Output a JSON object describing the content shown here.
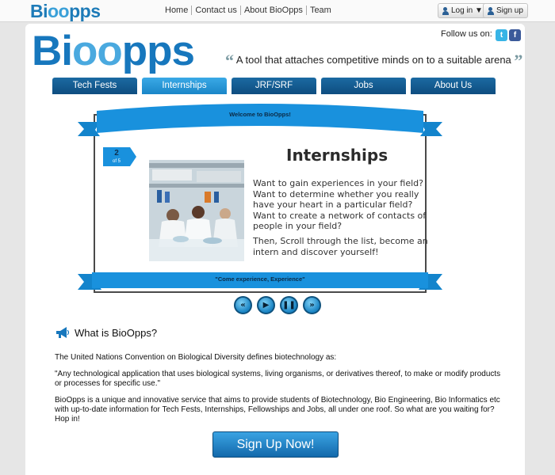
{
  "header": {
    "mini_logo_pre": "Bi",
    "mini_logo_dna": "oo",
    "mini_logo_post": "pps",
    "nav": [
      "Home",
      "Contact us",
      "About BioOpps",
      "Team"
    ],
    "login_label": "Log in ▼",
    "signup_label": "Sign up"
  },
  "brand": {
    "logo_pre": "Bi",
    "logo_dna": "oo",
    "logo_post": "pps",
    "follow_label": "Follow us on:",
    "tagline": "A tool that attaches competitive minds on to a suitable arena",
    "social": [
      "twitter-icon",
      "facebook-icon"
    ]
  },
  "tabs": [
    {
      "label": "Tech Fests",
      "active": false
    },
    {
      "label": "Internships",
      "active": true
    },
    {
      "label": "JRF/SRF",
      "active": false
    },
    {
      "label": "Jobs",
      "active": false
    },
    {
      "label": "About Us",
      "active": false
    }
  ],
  "slider": {
    "ribbon_top": "Welcome to BioOpps!",
    "ribbon_bottom": "\"Come experience, Experience\"",
    "badge_num": "2",
    "badge_of": "of 5",
    "title": "Internships",
    "para1": "Want to gain experiences in your field? Want to determine whether you really have your heart in a particular field? Want to create a network of contacts of people in your field?",
    "para2": "Then, Scroll through the list, become an intern and discover yourself!",
    "controls": [
      "«",
      "▶",
      "❚❚",
      "»"
    ]
  },
  "about": {
    "heading": "What is BioOpps?",
    "p1": "The United Nations Convention on Biological Diversity defines biotechnology as:",
    "p2": "\"Any technological application that uses biological systems, living organisms, or derivatives thereof, to make or modify products or processes for specific use.\"",
    "p3": "BioOpps is a unique and innovative service that aims to provide students of Biotechnology, Bio Engineering, Bio Informatics etc with up-to-date information for Tech Fests, Internships, Fellowships and Jobs, all under one roof. So what are you waiting for? Hop in!"
  },
  "cta": {
    "label": "Sign Up Now!"
  },
  "colors": {
    "brand_blue": "#1777bd",
    "tab_dark": "#0e4d80",
    "tab_active": "#1a86c8",
    "ribbon": "#1991dd"
  }
}
